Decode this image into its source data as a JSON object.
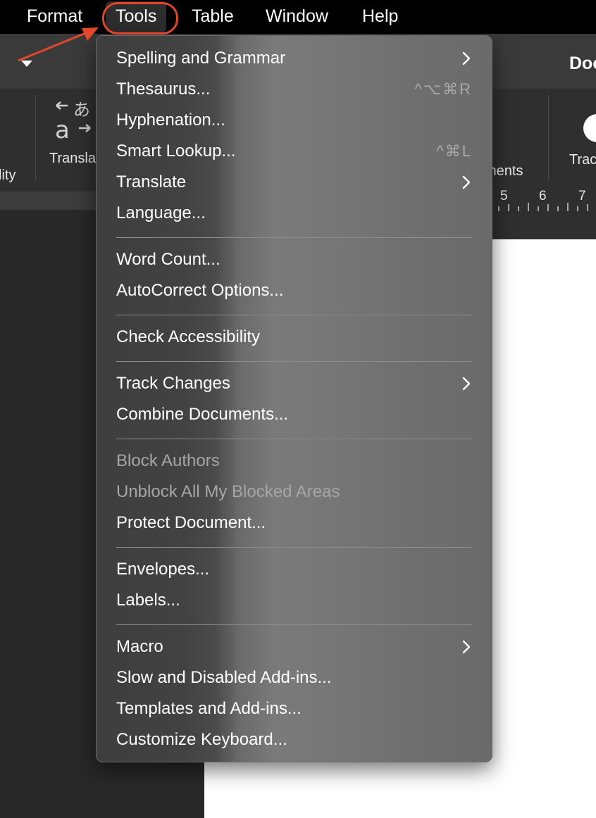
{
  "menubar": {
    "items": [
      {
        "label": "Format"
      },
      {
        "label": "Tools"
      },
      {
        "label": "Table"
      },
      {
        "label": "Window"
      },
      {
        "label": "Help"
      }
    ],
    "active": "Tools"
  },
  "titlebar": {
    "doc_title": "Doc"
  },
  "ribbon": {
    "accessibility_label": "lity",
    "translate_label": "Transla",
    "comments_label": "ments",
    "track_label": "Trac"
  },
  "ruler": {
    "numbers": [
      "5",
      "6",
      "7"
    ]
  },
  "tools_menu": {
    "items": [
      {
        "label": "Spelling and Grammar",
        "submenu": true
      },
      {
        "label": "Thesaurus...",
        "shortcut": "^⌥⌘R"
      },
      {
        "label": "Hyphenation..."
      },
      {
        "label": "Smart Lookup...",
        "shortcut": "^⌘L"
      },
      {
        "label": "Translate",
        "submenu": true
      },
      {
        "label": "Language..."
      },
      {
        "label": "Word Count..."
      },
      {
        "label": "AutoCorrect Options..."
      },
      {
        "label": "Check Accessibility"
      },
      {
        "label": "Track Changes",
        "submenu": true
      },
      {
        "label": "Combine Documents..."
      },
      {
        "label": "Block Authors",
        "disabled": true
      },
      {
        "label": "Unblock All My Blocked Areas",
        "disabled": true
      },
      {
        "label": "Protect Document..."
      },
      {
        "label": "Envelopes..."
      },
      {
        "label": "Labels..."
      },
      {
        "label": "Macro",
        "submenu": true
      },
      {
        "label": "Slow and Disabled Add-ins..."
      },
      {
        "label": "Templates and Add-ins..."
      },
      {
        "label": "Customize Keyboard..."
      }
    ]
  },
  "colors": {
    "menubar_bg": "#000000",
    "highlight": "#e2472c",
    "disabled_text": "#a6a6a6"
  }
}
